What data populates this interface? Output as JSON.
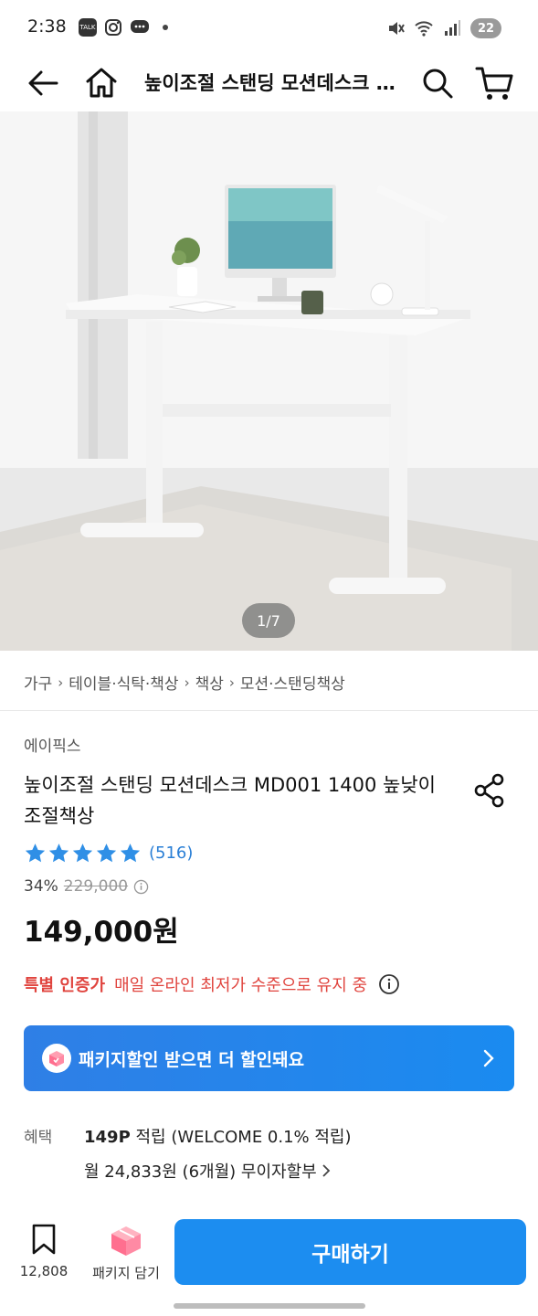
{
  "status_bar": {
    "time": "2:38",
    "left_icons": [
      "talk-icon",
      "instagram-icon",
      "chat-icon"
    ],
    "right_icons": [
      "mute-icon",
      "wifi-icon",
      "signal-icon"
    ],
    "battery": "22"
  },
  "nav": {
    "title": "높이조절 스탠딩 모션데스크 MD001 1400 높낮이조절책상"
  },
  "gallery": {
    "counter": "1/7"
  },
  "breadcrumb": [
    "가구",
    "테이블·식탁·책상",
    "책상",
    "모션·스탠딩책상"
  ],
  "product": {
    "brand": "에이픽스",
    "title": "높이조절 스탠딩 모션데스크 MD001 1400 높낮이조절책상",
    "rating_stars": 5,
    "review_count": "(516)",
    "discount": "34%",
    "original_price": "229,000",
    "sale_price": "149,000원"
  },
  "certification": {
    "label": "특별 인증가",
    "text": "매일 온라인 최저가 수준으로 유지 중"
  },
  "package_banner": {
    "text": "패키지할인 받으면 더 할인돼요"
  },
  "benefits": {
    "label": "혜택",
    "points_bold": "149P",
    "points_rest": " 적립 (WELCOME 0.1% 적립)",
    "installment": "월 24,833원 (6개월) 무이자할부"
  },
  "bottom_bar": {
    "wish_count": "12,808",
    "package_cart_label": "패키지 담기",
    "buy_label": "구매하기"
  },
  "colors": {
    "accent": "#1c8df0",
    "star": "#2f8fe6",
    "cert_red": "#e0443e"
  }
}
